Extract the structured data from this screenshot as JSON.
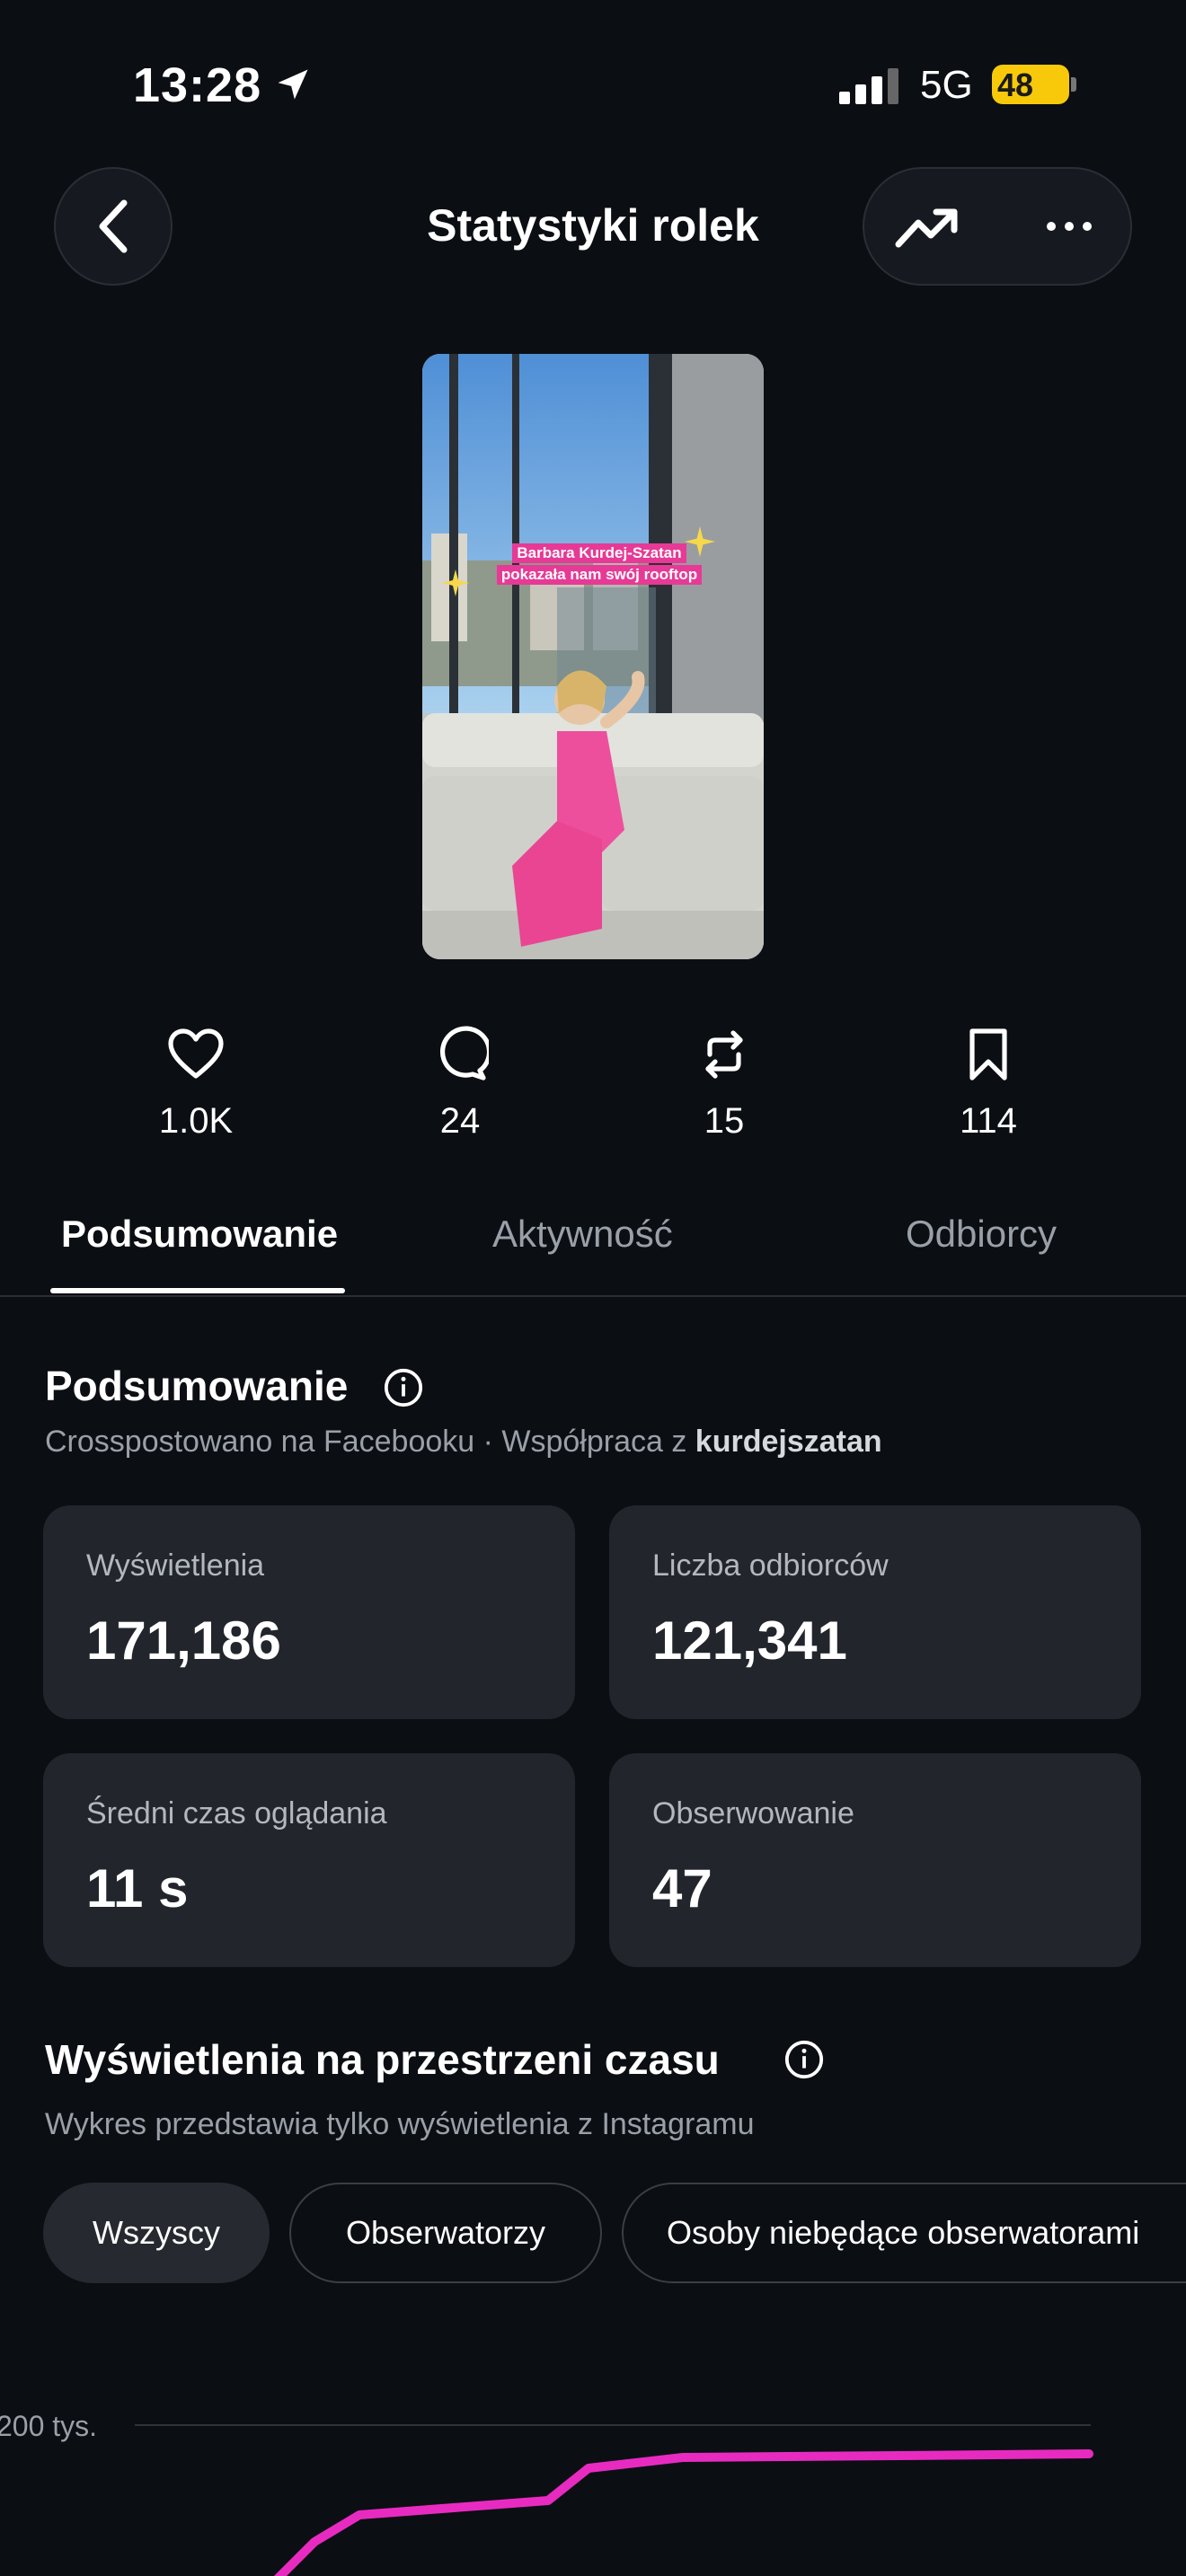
{
  "status_bar": {
    "time": "13:28",
    "network": "5G",
    "battery": "48"
  },
  "header": {
    "title": "Statystyki rolek"
  },
  "thumbnail": {
    "caption_line1": "Barbara Kurdej-Szatan",
    "caption_line2": "pokazała nam swój rooftop"
  },
  "metrics": {
    "likes": "1.0K",
    "comments": "24",
    "reposts": "15",
    "saves": "114"
  },
  "tabs": [
    "Podsumowanie",
    "Aktywność",
    "Odbiorcy"
  ],
  "summary": {
    "title": "Podsumowanie",
    "subtitle_prefix": "Crosspostowano na Facebooku · Współpraca z ",
    "collaborator": "kurdejszatan",
    "cards": [
      {
        "label": "Wyświetlenia",
        "value": "171,186"
      },
      {
        "label": "Liczba odbiorców",
        "value": "121,341"
      },
      {
        "label": "Średni czas oglądania",
        "value": "11 s"
      },
      {
        "label": "Obserwowanie",
        "value": "47"
      }
    ]
  },
  "views_over_time": {
    "title": "Wyświetlenia na przestrzeni czasu",
    "subtitle": "Wykres przedstawia tylko wyświetlenia z Instagramu",
    "filters": [
      "Wszyscy",
      "Obserwatorzy",
      "Osoby niebędące obserwatorami"
    ],
    "active_filter": "Wszyscy"
  },
  "chart_data": {
    "type": "line",
    "tick_labels": [
      "200 tys."
    ],
    "ylim": [
      0,
      200000
    ],
    "series": [
      {
        "values": [
          100000,
          135000,
          150000,
          158000,
          176000,
          182000,
          183000,
          184000
        ]
      }
    ],
    "line_color": "#e82bc0"
  },
  "colors": {
    "accent_line": "#e82bc0",
    "background": "#0b0e13",
    "card": "#22262c"
  }
}
